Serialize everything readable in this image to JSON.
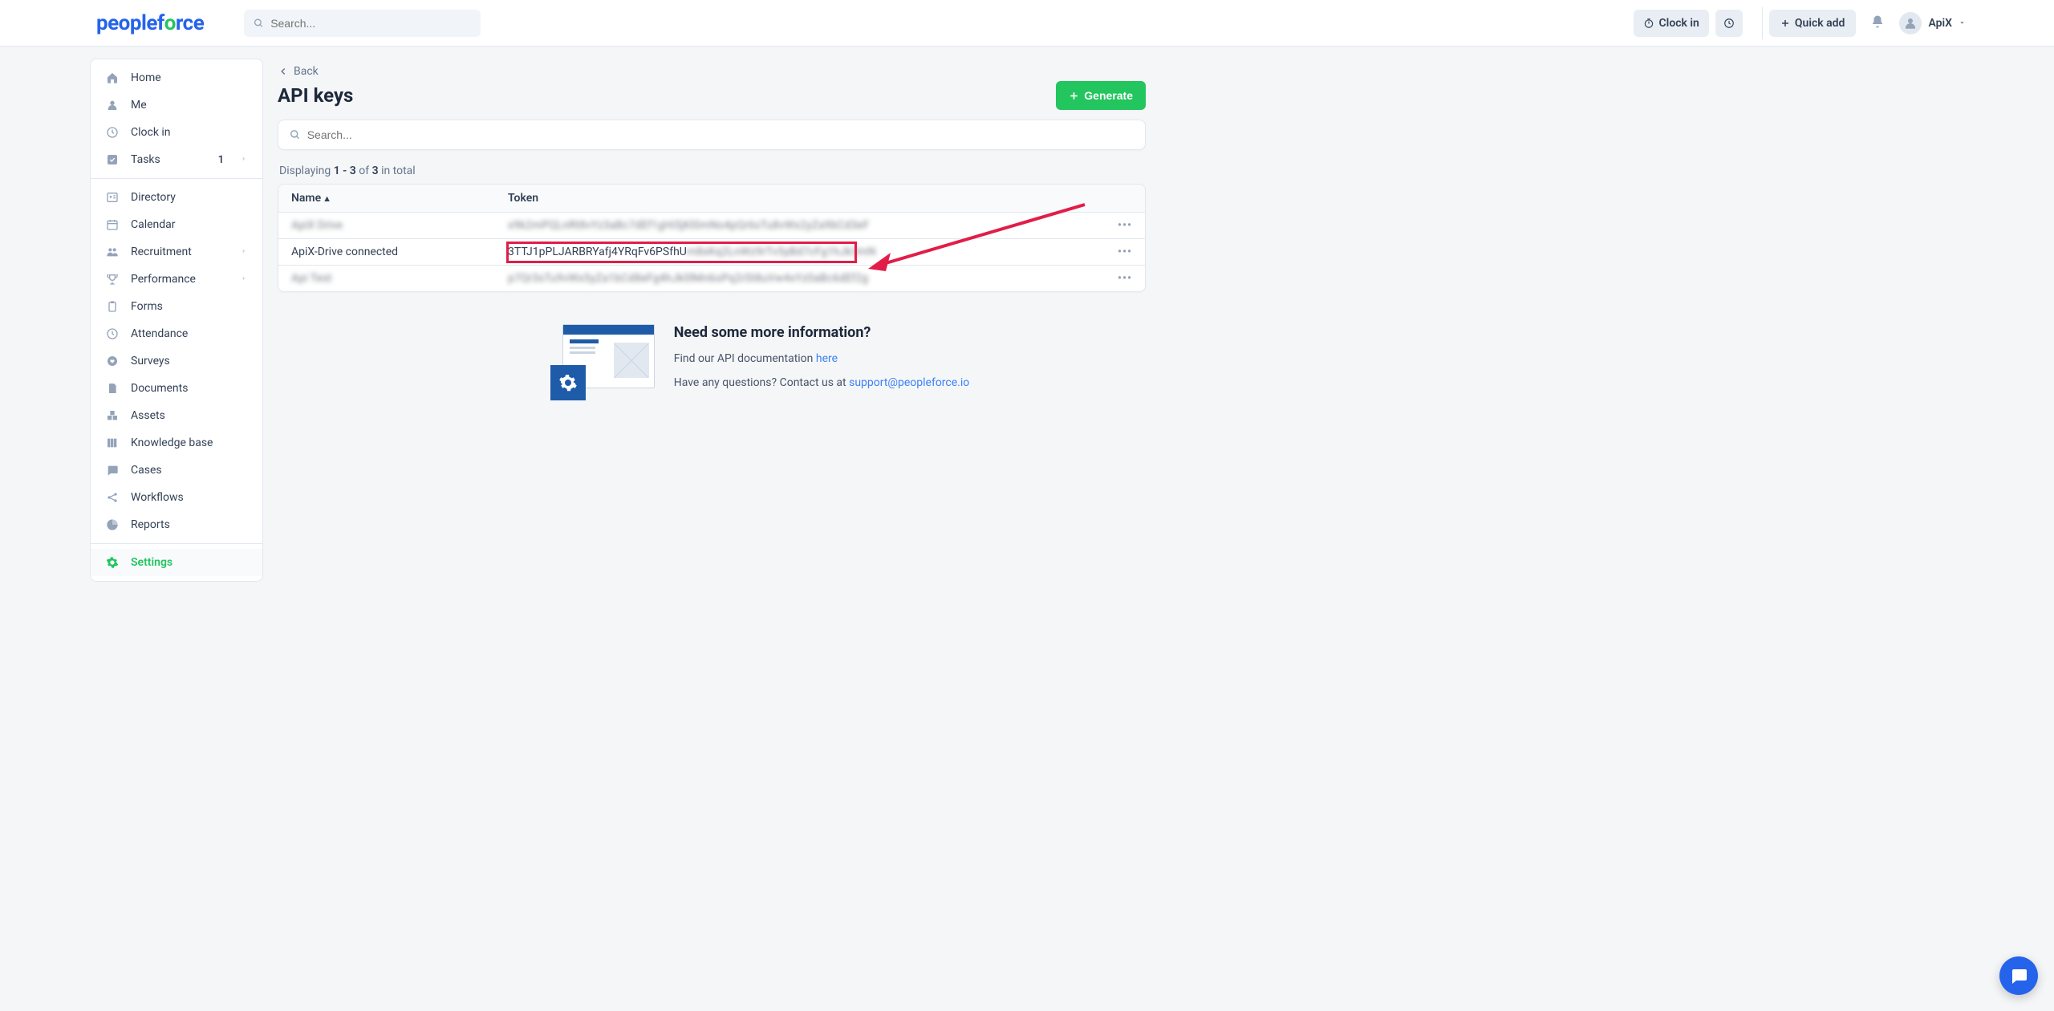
{
  "header": {
    "logo_part1": "people",
    "logo_part2": "f",
    "logo_o": "o",
    "logo_part3": "rce",
    "search_placeholder": "Search...",
    "clock_in": "Clock in",
    "quick_add": "Quick add",
    "user_name": "ApiX"
  },
  "sidebar": {
    "section1": [
      {
        "label": "Home",
        "icon": "home"
      },
      {
        "label": "Me",
        "icon": "user"
      },
      {
        "label": "Clock in",
        "icon": "clock"
      },
      {
        "label": "Tasks",
        "icon": "check",
        "badge": "1",
        "chevron": true
      }
    ],
    "section2": [
      {
        "label": "Directory",
        "icon": "id"
      },
      {
        "label": "Calendar",
        "icon": "calendar"
      },
      {
        "label": "Recruitment",
        "icon": "people",
        "chevron": true
      },
      {
        "label": "Performance",
        "icon": "trophy",
        "chevron": true
      },
      {
        "label": "Forms",
        "icon": "clipboard"
      },
      {
        "label": "Attendance",
        "icon": "clock"
      },
      {
        "label": "Surveys",
        "icon": "heart"
      },
      {
        "label": "Documents",
        "icon": "file"
      },
      {
        "label": "Assets",
        "icon": "boxes"
      },
      {
        "label": "Knowledge base",
        "icon": "books"
      },
      {
        "label": "Cases",
        "icon": "chat"
      },
      {
        "label": "Workflows",
        "icon": "share"
      },
      {
        "label": "Reports",
        "icon": "pie"
      }
    ],
    "section3": [
      {
        "label": "Settings",
        "icon": "gear",
        "active": true
      }
    ]
  },
  "main": {
    "back": "Back",
    "title": "API keys",
    "generate": "Generate",
    "search_placeholder": "Search...",
    "display_pre": "Displaying ",
    "display_range": "1 - 3",
    "display_of": " of ",
    "display_total": "3",
    "display_post": " in total",
    "col_name": "Name",
    "col_token": "Token",
    "rows": [
      {
        "name": "ApiX Drive",
        "token": "x9k2mPQLnRt8vYz3aBc7dEf1gHi5jKl0mNo4pQr6sTu8vWx2yZa9bCd3eF",
        "blurred": true
      },
      {
        "name": "ApiX-Drive connected",
        "token": "3TTJ1pPLJARBRYafj4YRqFv6PSfhUm8xKq2LnWz9rTv5yBd7cFg1hJk3mN",
        "highlight": true
      },
      {
        "name": "Api Test",
        "token": "p7Qr3sTu9vWx5yZa1bCd8eFg4hJk0lMn6oPq2rSt8uVw4xYz0aBc6dEf2g",
        "blurred": true
      }
    ]
  },
  "info": {
    "heading": "Need some more information?",
    "doc_text": "Find our API documentation ",
    "doc_link": "here",
    "contact_text": "Have any questions? Contact us at ",
    "contact_email": "support@peopleforce.io"
  }
}
